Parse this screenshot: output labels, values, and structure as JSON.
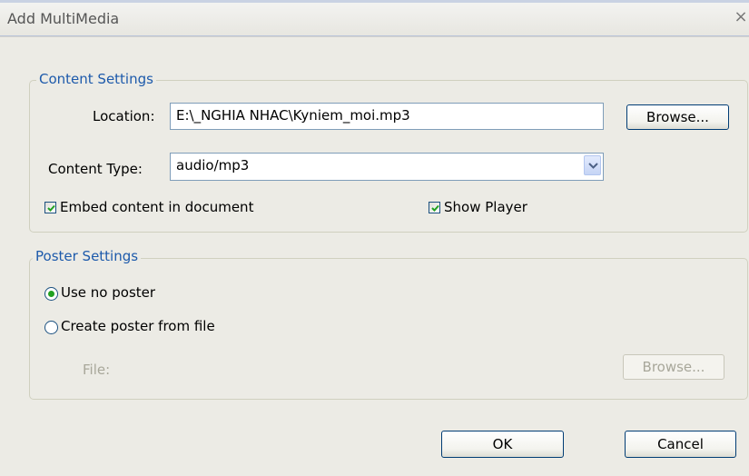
{
  "window": {
    "title": "Add MultiMedia",
    "close_glyph": "×"
  },
  "content_settings": {
    "legend": "Content Settings",
    "location_label": "Location:",
    "location_value": "E:\\_NGHIA NHAC\\Kyniem_moi.mp3",
    "browse_label": "Browse...",
    "content_type_label": "Content Type:",
    "content_type_value": "audio/mp3",
    "embed_label": "Embed content in document",
    "embed_checked": true,
    "show_player_label": "Show Player",
    "show_player_checked": true
  },
  "poster_settings": {
    "legend": "Poster Settings",
    "use_no_poster_label": "Use no poster",
    "use_no_poster_selected": true,
    "create_poster_label": "Create poster from file",
    "create_poster_selected": false,
    "file_label": "File:",
    "browse_label": "Browse..."
  },
  "footer": {
    "ok_label": "OK",
    "cancel_label": "Cancel"
  },
  "colors": {
    "legend": "#1d5aab",
    "check_mark": "#21a121",
    "dialog_bg": "#ecebe5",
    "button_border": "#003c74"
  }
}
